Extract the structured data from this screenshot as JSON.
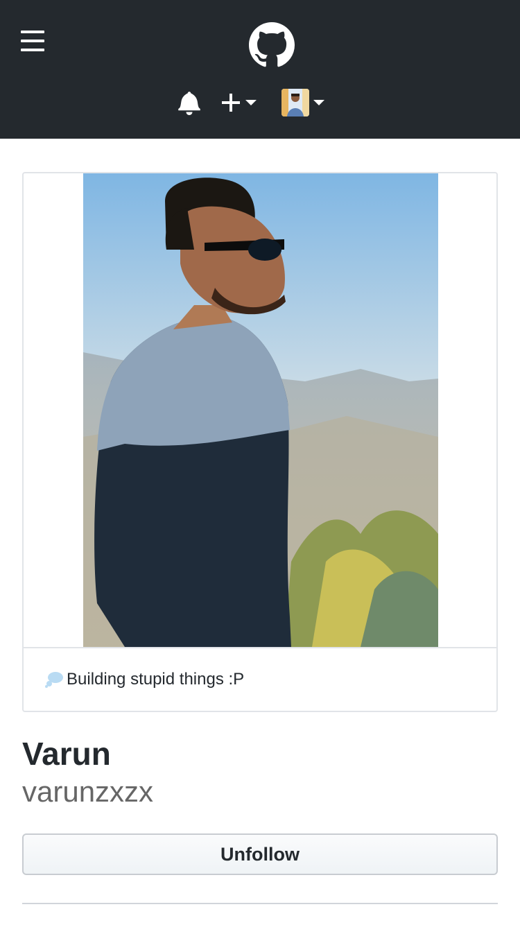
{
  "header": {
    "menu_icon": "hamburger-menu-icon",
    "logo_icon": "github-octocat-icon",
    "notifications_icon": "bell-icon",
    "create_icon": "plus-icon",
    "avatar_icon": "user-avatar"
  },
  "profile": {
    "status_emoji": "thought-balloon-icon",
    "status_text": "Building stupid things :P",
    "full_name": "Varun",
    "username": "varunzxzx",
    "follow_button_label": "Unfollow"
  },
  "colors": {
    "header_bg": "#24292e",
    "text_primary": "#24292e",
    "text_muted": "#666666",
    "border": "#e1e4e8"
  }
}
